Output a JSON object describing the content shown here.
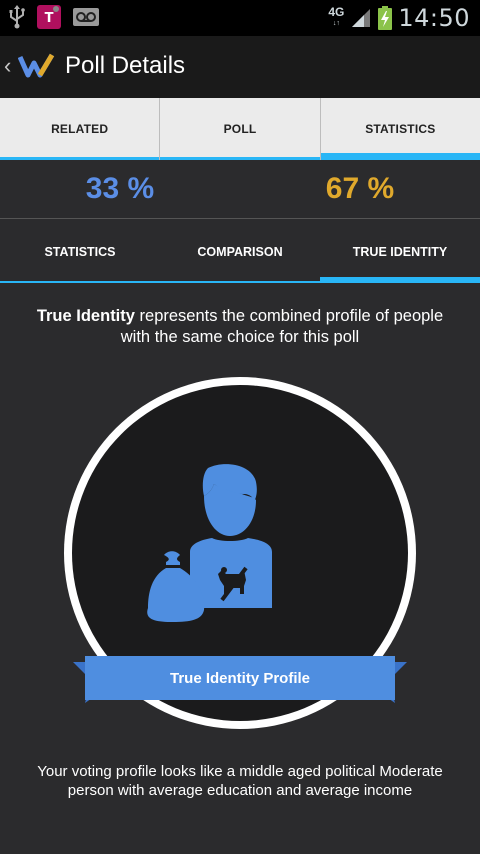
{
  "status_bar": {
    "time": "14:50",
    "network": "4G",
    "network_sub": "↓↑",
    "icons": [
      "usb-icon",
      "t-mobile-app-icon",
      "voicemail-icon",
      "signal-icon",
      "battery-charging-icon"
    ]
  },
  "action_bar": {
    "title": "Poll Details",
    "back_icon": "chevron-left-icon",
    "logo_icon": "app-logo-icon"
  },
  "top_tabs": [
    {
      "label": "RELATED",
      "active": false
    },
    {
      "label": "POLL",
      "active": false
    },
    {
      "label": "STATISTICS",
      "active": true
    }
  ],
  "percents": [
    {
      "value": "33 %",
      "color": "#5b8ee6"
    },
    {
      "value": "67 %",
      "color": "#e0a92c"
    }
  ],
  "sub_tabs": [
    {
      "label": "STATISTICS",
      "active": false
    },
    {
      "label": "COMPARISON",
      "active": false
    },
    {
      "label": "TRUE IDENTITY",
      "active": true
    }
  ],
  "description": {
    "bold": "True Identity",
    "rest": " represents the combined profile of people with the same choice for this poll"
  },
  "profile": {
    "ribbon_label": "True Identity Profile",
    "icons": [
      "person-icon",
      "money-bag-icon",
      "no-pets-icon"
    ],
    "accent_color": "#4f8ee0"
  },
  "summary": "Your voting profile looks like a  middle aged political Moderate person with average education and average income",
  "colors": {
    "tab_indicator": "#29b6f6",
    "background": "#2b2b2d"
  }
}
